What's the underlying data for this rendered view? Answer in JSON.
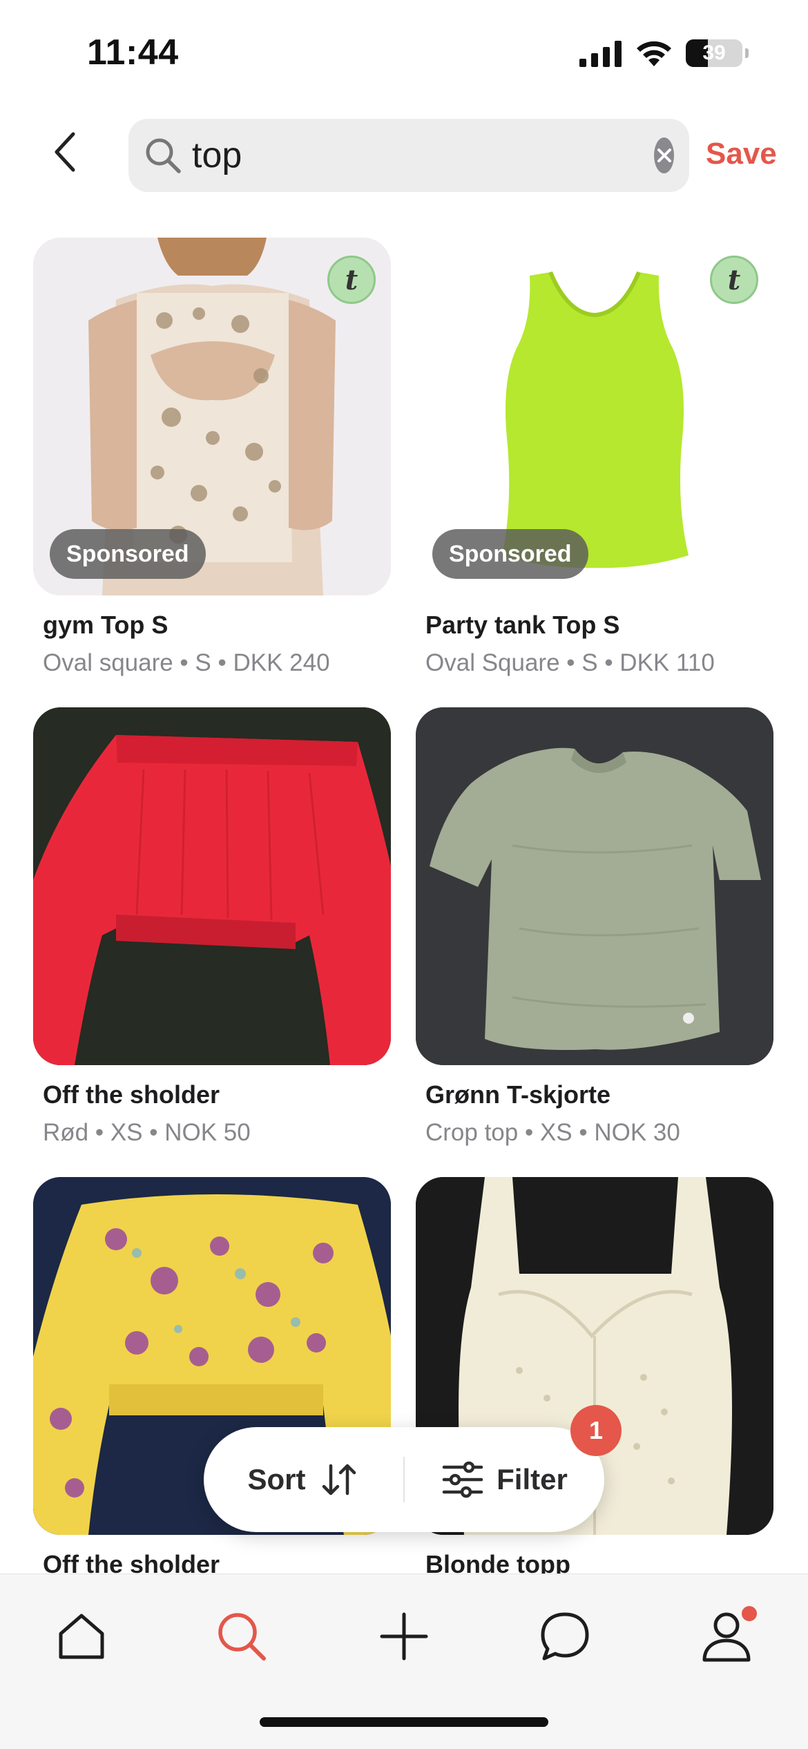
{
  "status_bar": {
    "time": "11:44",
    "battery": "39"
  },
  "search": {
    "query": "top",
    "save_label": "Save"
  },
  "products": [
    {
      "title": "gym Top S",
      "meta": "Oval square • S • DKK 240",
      "sponsored": true,
      "sponsored_label": "Sponsored",
      "image": "patterned-cutout-top"
    },
    {
      "title": "Party tank Top S",
      "meta": "Oval Square • S • DKK 110",
      "sponsored": true,
      "sponsored_label": "Sponsored",
      "image": "lime-tank-top"
    },
    {
      "title": "Off the sholder",
      "meta": "Rød • XS • NOK 50",
      "sponsored": false,
      "image": "red-off-shoulder-top"
    },
    {
      "title": "Grønn T-skjorte",
      "meta": "Crop top • XS • NOK 30",
      "sponsored": false,
      "image": "green-tshirt"
    },
    {
      "title": "Off the sholder",
      "meta": "",
      "sponsored": false,
      "image": "yellow-floral-top"
    },
    {
      "title": "Blonde topp",
      "meta": "",
      "sponsored": false,
      "image": "white-lace-top"
    }
  ],
  "sort_filter": {
    "sort_label": "Sort",
    "filter_label": "Filter",
    "filter_count": "1"
  },
  "tabs": [
    "home-icon",
    "search-icon",
    "plus-icon",
    "chat-icon",
    "profile-icon"
  ],
  "colors": {
    "accent": "#e4574a",
    "muted_text": "#86868b",
    "badge_green": "#b7e0b0"
  }
}
